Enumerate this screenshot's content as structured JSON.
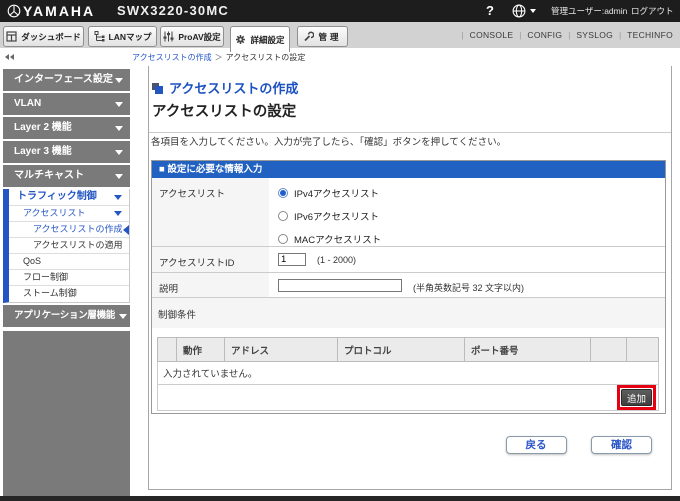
{
  "topbar": {
    "brand": "YAMAHA",
    "model": "SWX3220-30MC",
    "help": "?",
    "user_label": "管理ユーザー:admin",
    "logout": "ログアウト"
  },
  "tabbar": {
    "tabs": [
      {
        "label": "ダッシュボード"
      },
      {
        "label": "LANマップ"
      },
      {
        "label": "ProAV設定"
      },
      {
        "label": "詳細設定"
      },
      {
        "label": "管理"
      }
    ],
    "links": [
      "CONSOLE",
      "CONFIG",
      "SYSLOG",
      "TECHINFO"
    ]
  },
  "breadcrumb": {
    "items": [
      "アクセスリストの作成",
      "アクセスリストの設定"
    ],
    "separator": "＞"
  },
  "sidebar": {
    "items": [
      {
        "label": "インターフェース設定"
      },
      {
        "label": "VLAN"
      },
      {
        "label": "Layer 2 機能"
      },
      {
        "label": "Layer 3 機能"
      },
      {
        "label": "マルチキャスト"
      },
      {
        "label": "トラフィック制御"
      },
      {
        "label": "アクセスリスト"
      },
      {
        "label": "アクセスリストの作成"
      },
      {
        "label": "アクセスリストの適用"
      },
      {
        "label": "QoS"
      },
      {
        "label": "フロー制御"
      },
      {
        "label": "ストーム制御"
      },
      {
        "label": "アプリケーション層機能"
      }
    ]
  },
  "main": {
    "title": "アクセスリストの作成",
    "subtitle": "アクセスリストの設定",
    "instruction": "各項目を入力してください。入力が完了したら、「確認」ボタンを押してください。",
    "section_header": "■ 設定に必要な情報入力",
    "form": {
      "access_list_label": "アクセスリスト",
      "radios": [
        {
          "label": "IPv4アクセスリスト",
          "selected": true
        },
        {
          "label": "IPv6アクセスリスト",
          "selected": false
        },
        {
          "label": "MACアクセスリスト",
          "selected": false
        }
      ],
      "id_label": "アクセスリストID",
      "id_value": "1",
      "id_hint": "(1 - 2000)",
      "desc_label": "説明",
      "desc_value": "",
      "desc_hint": "(半角英数記号 32 文字以内)",
      "conditions_label": "制御条件",
      "table": {
        "headers": [
          "",
          "動作",
          "アドレス",
          "プロトコル",
          "ポート番号",
          "",
          ""
        ],
        "empty_message": "入力されていません。",
        "add_button": "追加"
      }
    },
    "back_button": "戻る",
    "confirm_button": "確認"
  }
}
